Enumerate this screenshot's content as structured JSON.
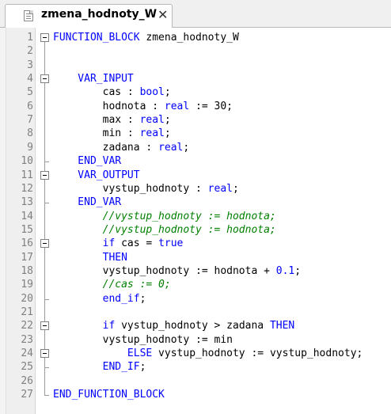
{
  "tab": {
    "title": "zmena_hodnoty_W",
    "close_glyph": "✕",
    "icon": "document-icon"
  },
  "editor": {
    "colors": {
      "keyword": "#0000ff",
      "comment": "#008000",
      "text": "#000000",
      "line_number": "#808080"
    },
    "lines": [
      {
        "n": "1",
        "segments": [
          {
            "t": "FUNCTION_BLOCK",
            "c": "kw"
          },
          {
            "t": " zmena_hodnoty_W",
            "c": ""
          }
        ]
      },
      {
        "n": "2",
        "segments": []
      },
      {
        "n": "3",
        "segments": []
      },
      {
        "n": "4",
        "segments": [
          {
            "t": "    VAR_INPUT",
            "c": "kw"
          }
        ]
      },
      {
        "n": "5",
        "segments": [
          {
            "t": "        cas : ",
            "c": ""
          },
          {
            "t": "bool",
            "c": "kw"
          },
          {
            "t": ";",
            "c": ""
          }
        ]
      },
      {
        "n": "6",
        "segments": [
          {
            "t": "        hodnota : ",
            "c": ""
          },
          {
            "t": "real",
            "c": "kw"
          },
          {
            "t": " := 30;",
            "c": ""
          }
        ]
      },
      {
        "n": "7",
        "segments": [
          {
            "t": "        max : ",
            "c": ""
          },
          {
            "t": "real",
            "c": "kw"
          },
          {
            "t": ";",
            "c": ""
          }
        ]
      },
      {
        "n": "8",
        "segments": [
          {
            "t": "        min : ",
            "c": ""
          },
          {
            "t": "real",
            "c": "kw"
          },
          {
            "t": ";",
            "c": ""
          }
        ]
      },
      {
        "n": "9",
        "segments": [
          {
            "t": "        zadana : ",
            "c": ""
          },
          {
            "t": "real",
            "c": "kw"
          },
          {
            "t": ";",
            "c": ""
          }
        ]
      },
      {
        "n": "10",
        "segments": [
          {
            "t": "    END_VAR",
            "c": "kw"
          }
        ]
      },
      {
        "n": "11",
        "segments": [
          {
            "t": "    VAR_OUTPUT",
            "c": "kw"
          }
        ]
      },
      {
        "n": "12",
        "segments": [
          {
            "t": "        vystup_hodnoty : ",
            "c": ""
          },
          {
            "t": "real",
            "c": "kw"
          },
          {
            "t": ";",
            "c": ""
          }
        ]
      },
      {
        "n": "13",
        "segments": [
          {
            "t": "    END_VAR",
            "c": "kw"
          }
        ]
      },
      {
        "n": "14",
        "segments": [
          {
            "t": "        //vystup_hodnoty := hodnota;",
            "c": "cm"
          }
        ]
      },
      {
        "n": "15",
        "segments": [
          {
            "t": "        //vystup_hodnoty := hodnota;",
            "c": "cm"
          }
        ]
      },
      {
        "n": "16",
        "segments": [
          {
            "t": "        ",
            "c": ""
          },
          {
            "t": "if",
            "c": "kw"
          },
          {
            "t": " cas = ",
            "c": ""
          },
          {
            "t": "true",
            "c": "kw"
          }
        ]
      },
      {
        "n": "17",
        "segments": [
          {
            "t": "        THEN",
            "c": "kw"
          }
        ]
      },
      {
        "n": "18",
        "segments": [
          {
            "t": "        vystup_hodnoty := hodnota + ",
            "c": ""
          },
          {
            "t": "0.1",
            "c": "kw"
          },
          {
            "t": ";",
            "c": ""
          }
        ]
      },
      {
        "n": "19",
        "segments": [
          {
            "t": "        //cas := 0;",
            "c": "cm"
          }
        ]
      },
      {
        "n": "20",
        "segments": [
          {
            "t": "        end_if",
            "c": "kw"
          },
          {
            "t": ";",
            "c": ""
          }
        ]
      },
      {
        "n": "21",
        "segments": []
      },
      {
        "n": "22",
        "segments": [
          {
            "t": "        ",
            "c": ""
          },
          {
            "t": "if",
            "c": "kw"
          },
          {
            "t": " vystup_hodnoty > zadana ",
            "c": ""
          },
          {
            "t": "THEN",
            "c": "kw"
          }
        ]
      },
      {
        "n": "23",
        "segments": [
          {
            "t": "        vystup_hodnoty := min",
            "c": ""
          }
        ]
      },
      {
        "n": "24",
        "segments": [
          {
            "t": "            ",
            "c": ""
          },
          {
            "t": "ELSE",
            "c": "kw"
          },
          {
            "t": " vystup_hodnoty := vystup_hodnoty;",
            "c": ""
          }
        ]
      },
      {
        "n": "25",
        "segments": [
          {
            "t": "        END_IF",
            "c": "kw"
          },
          {
            "t": ";",
            "c": ""
          }
        ]
      },
      {
        "n": "26",
        "segments": []
      },
      {
        "n": "27",
        "segments": [
          {
            "t": "END_FUNCTION_BLOCK",
            "c": "kw"
          }
        ]
      }
    ]
  }
}
